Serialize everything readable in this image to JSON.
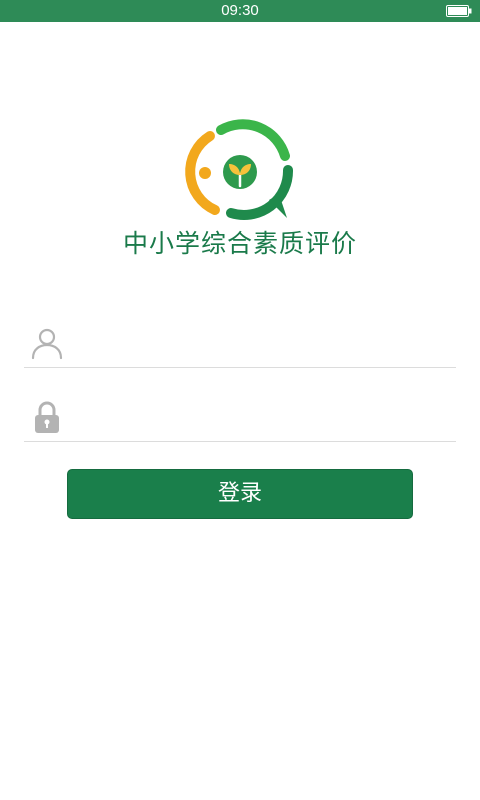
{
  "status_bar": {
    "time": "09:30",
    "battery_icon": "battery-full-icon",
    "background": "#2e8b57"
  },
  "app": {
    "logo_icon": "sprout-circle-logo",
    "title": "中小学综合素质评价"
  },
  "login_form": {
    "username": {
      "icon": "user-icon",
      "value": "",
      "placeholder": ""
    },
    "password": {
      "icon": "lock-icon",
      "value": "",
      "placeholder": ""
    },
    "submit_label": "登录"
  },
  "colors": {
    "brand_green": "#1a7f4b",
    "title_green": "#1a7a4a",
    "logo_orange": "#f2a81d",
    "logo_light_green": "#3bb54a",
    "icon_gray": "#b3b3b3"
  }
}
